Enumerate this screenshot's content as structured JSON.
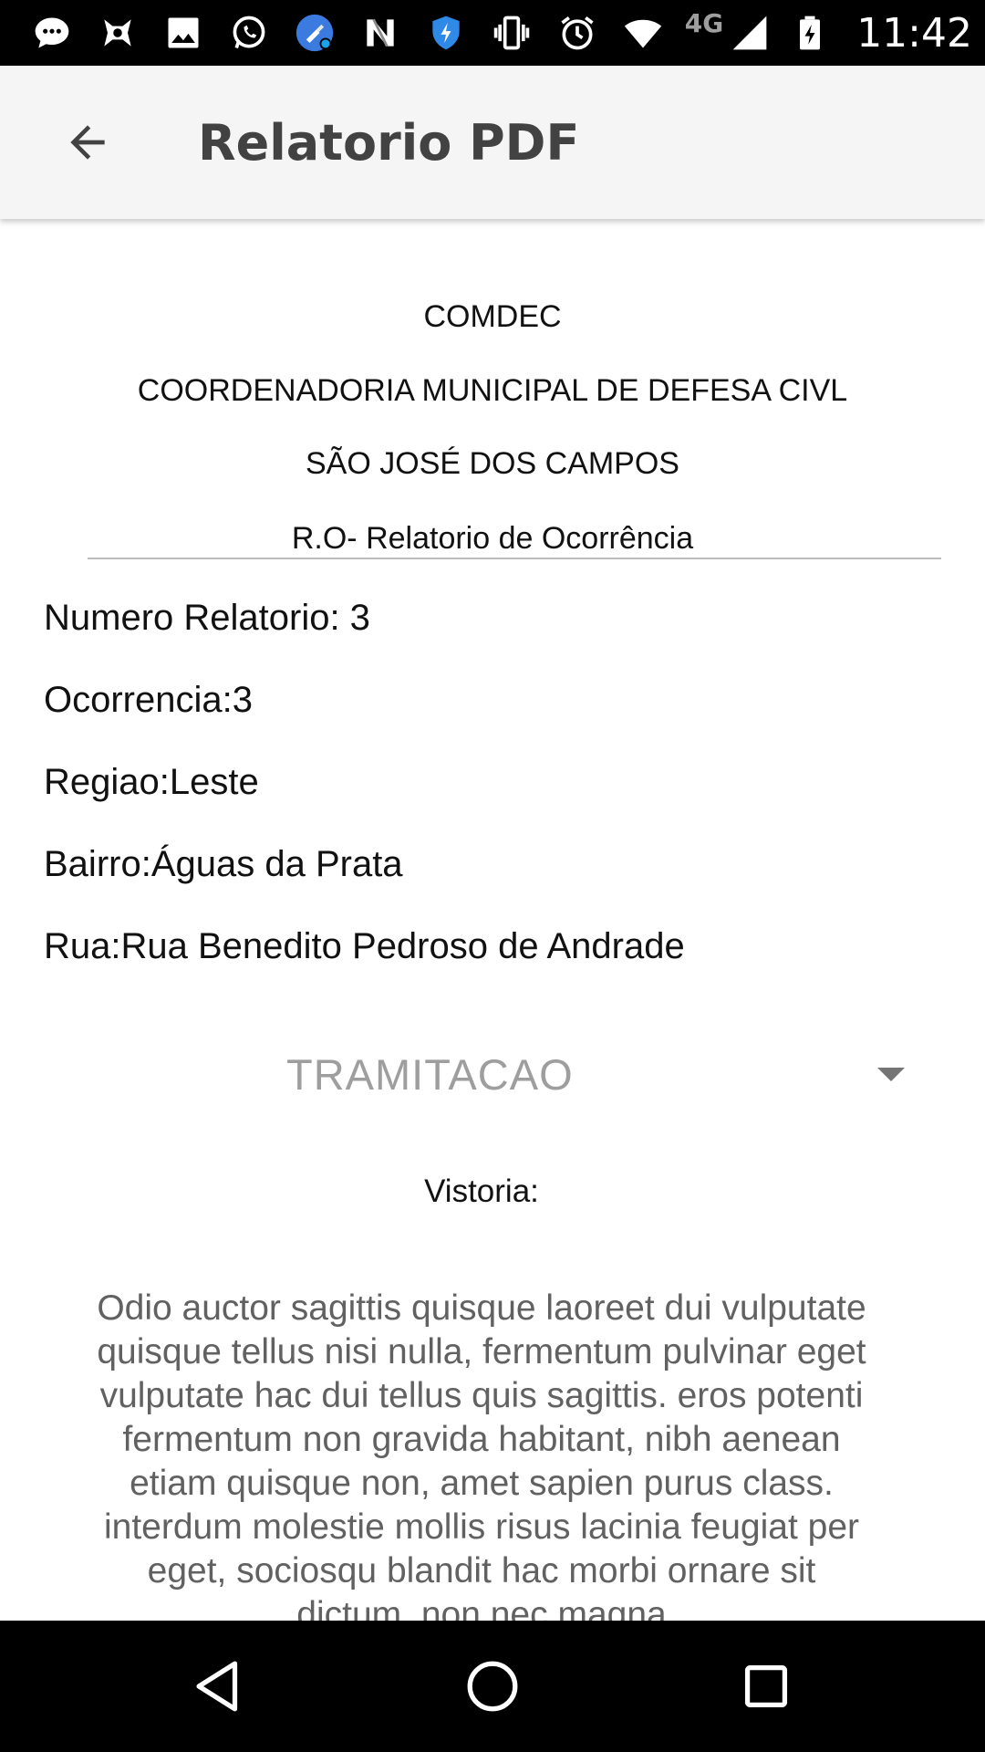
{
  "status_bar": {
    "icons": [
      "messaging-icon",
      "game-controller-icon",
      "gallery-icon",
      "whatsapp-icon",
      "cleaner-app-icon",
      "n-app-icon",
      "shield-icon",
      "vibrate-icon",
      "alarm-icon",
      "wifi-icon"
    ],
    "network": "4G",
    "time": "11:42"
  },
  "app_bar": {
    "back_icon": "arrow-left-icon",
    "title": "Relatorio PDF"
  },
  "report_header": {
    "line1": "COMDEC",
    "line2": "COORDENADORIA MUNICIPAL DE DEFESA CIVL",
    "line3": "SÃO JOSÉ DOS CAMPOS",
    "line4": "R.O- Relatorio de Ocorrência"
  },
  "fields": {
    "numero_relatorio": "Numero Relatorio: 3",
    "ocorrencia": "Ocorrencia:3",
    "regiao": "Regiao:Leste",
    "bairro": "Bairro:Águas da Prata",
    "rua": "Rua:Rua Benedito Pedroso de Andrade"
  },
  "dropdown": {
    "selected": "TRAMITACAO"
  },
  "vistoria": {
    "label": "Vistoria:",
    "text": "Odio auctor sagittis quisque laoreet dui vulputate quisque tellus nisi nulla, fermentum pulvinar eget vulputate hac dui tellus quis sagittis. eros potenti fermentum non gravida habitant, nibh aenean etiam quisque non, amet sapien purus class. interdum molestie mollis risus lacinia feugiat per eget, sociosqu blandit hac morbi ornare sit dictum, non nec magna"
  },
  "nav_bar": {
    "back_icon": "nav-back-triangle-icon",
    "home_icon": "nav-home-circle-icon",
    "recents_icon": "nav-recents-square-icon"
  },
  "colors": {
    "app_bar_bg": "#f5f5f5",
    "title_text": "#424242",
    "hint_text": "#9e9e9e",
    "body_gray": "#616161"
  }
}
